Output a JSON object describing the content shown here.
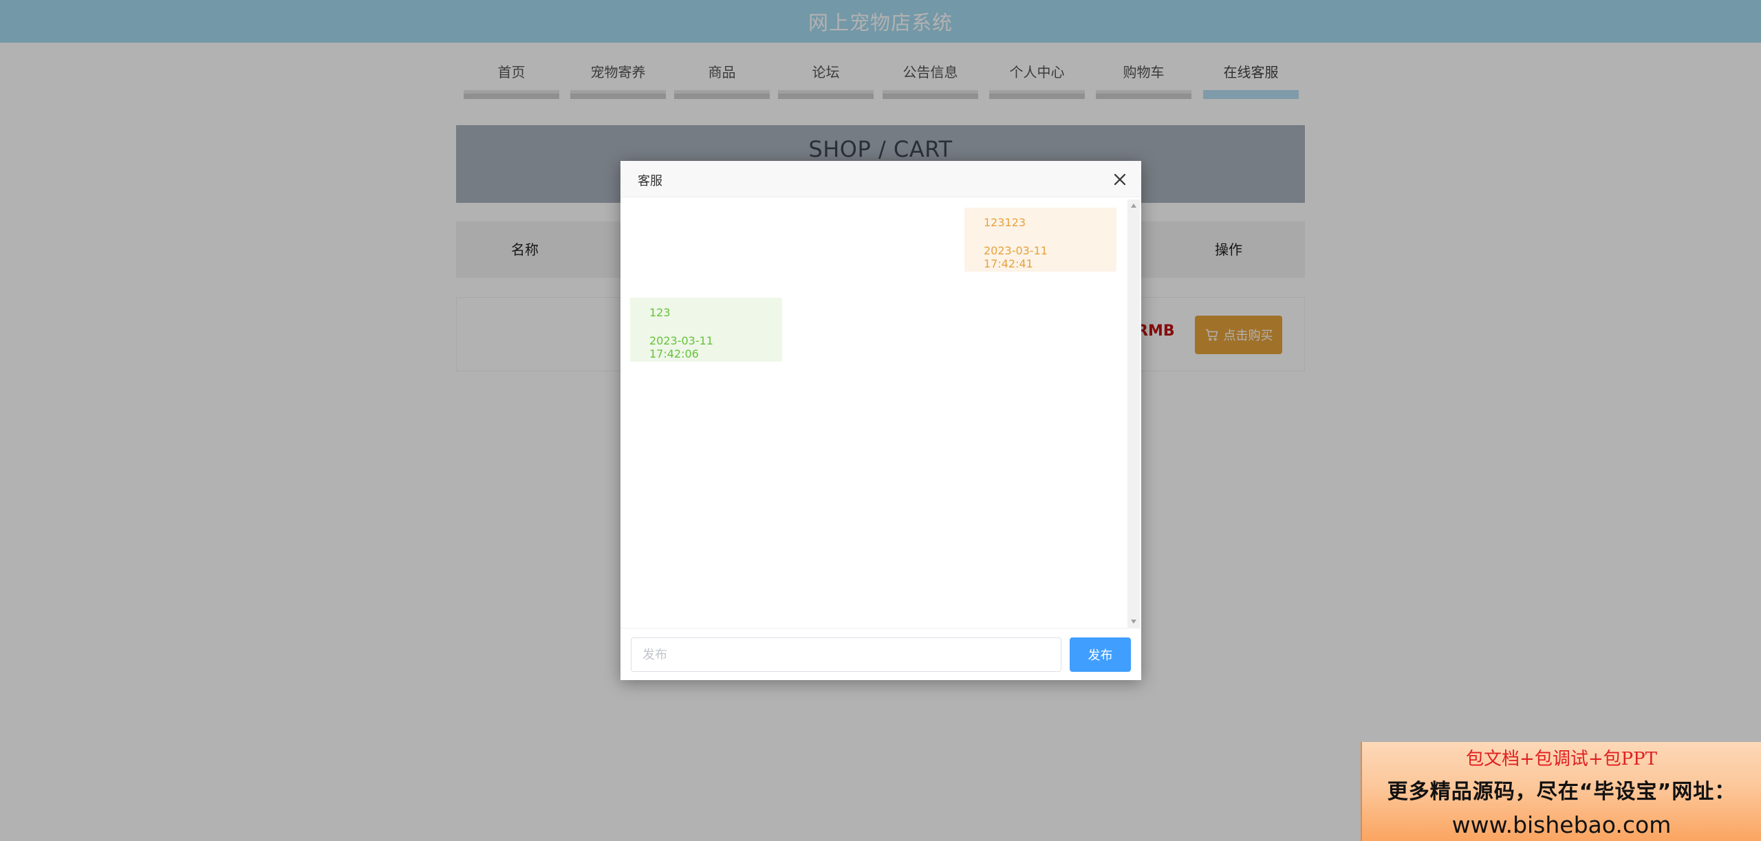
{
  "site": {
    "title": "网上宠物店系统"
  },
  "nav": {
    "items": [
      {
        "label": "首页"
      },
      {
        "label": "宠物寄养"
      },
      {
        "label": "商品"
      },
      {
        "label": "论坛"
      },
      {
        "label": "公告信息"
      },
      {
        "label": "个人中心"
      },
      {
        "label": "购物车"
      },
      {
        "label": "在线客服"
      }
    ],
    "active": "在线客服"
  },
  "banner": {
    "title": "SHOP / CART"
  },
  "cart": {
    "columns": {
      "name": "名称",
      "operation": "操作"
    },
    "row": {
      "price_unit": "RMB",
      "buy_label": "点击购买"
    }
  },
  "dialog": {
    "title": "客服",
    "messages": [
      {
        "side": "right",
        "text": "123123",
        "time": "2023-03-11 17:42:41"
      },
      {
        "side": "left",
        "text": "123",
        "time": "2023-03-11 17:42:06"
      }
    ],
    "input": {
      "placeholder": "发布",
      "value": ""
    },
    "send_label": "发布"
  },
  "ad": {
    "line1": "包文档+包调试+包PPT",
    "line2": "更多精品源码，尽在“毕设宝”网址：",
    "line3": "www.bishebao.com"
  },
  "colors": {
    "header_bg": "#a5daf0",
    "active_nav": "#b7dff2",
    "buy_button": "#e6a23c",
    "send_button": "#409eff",
    "agent_bubble": "#fdf3e7",
    "user_bubble": "#eef7e8",
    "price_red": "#c01313"
  }
}
